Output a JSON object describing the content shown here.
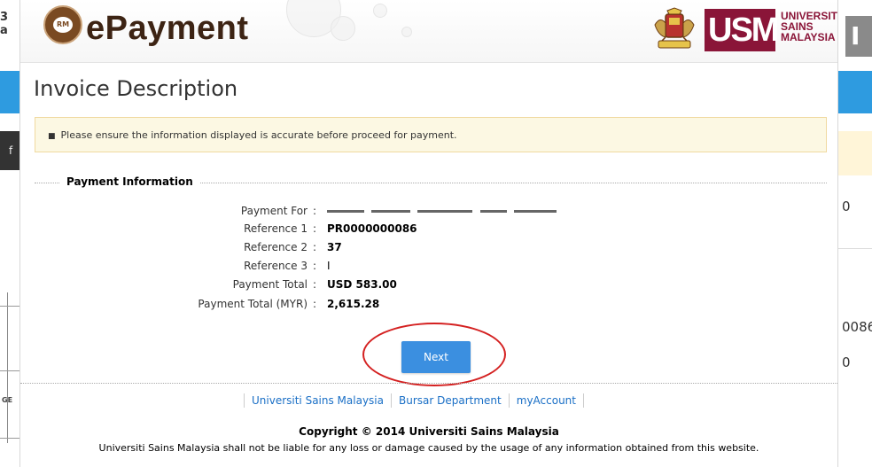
{
  "background": {
    "left_text": [
      "3",
      "a"
    ],
    "left_dark_text": "f",
    "left_ge_text": "GE",
    "right_gray_text": "I",
    "right_texts": [
      "0",
      "0086",
      "0"
    ]
  },
  "header": {
    "logo_text": "RM",
    "brand": "ePayment",
    "usm_letters": "USM",
    "usm_name_lines": [
      "UNIVERSITI",
      "SAINS",
      "MALAYSIA"
    ]
  },
  "page_title": "Invoice Description",
  "notice": "Please ensure the information displayed is accurate before proceed for payment.",
  "section_title": "Payment Information",
  "payment_info": [
    {
      "label": "Payment For",
      "value": ""
    },
    {
      "label": "Reference 1",
      "value": "PR0000000086"
    },
    {
      "label": "Reference 2",
      "value": "37"
    },
    {
      "label": "Reference 3",
      "value": "I"
    },
    {
      "label": "Payment Total",
      "value": "USD 583.00"
    },
    {
      "label": "Payment Total (MYR)",
      "value": "2,615.28"
    }
  ],
  "colon": ":",
  "next_label": "Next",
  "footer": {
    "links": [
      "Universiti Sains Malaysia",
      "Bursar Department",
      "myAccount"
    ],
    "copyright": "Copyright © 2014 Universiti Sains Malaysia",
    "disclaimer": "Universiti Sains Malaysia shall not be liable for any loss or damage caused by the usage of any information obtained from this website."
  },
  "colors": {
    "accent_blue": "#3b8fe0",
    "brand_brown": "#3d2414",
    "usm_maroon": "#8a1538",
    "notice_bg": "#fcf8e3",
    "highlight_red": "#d42020"
  }
}
